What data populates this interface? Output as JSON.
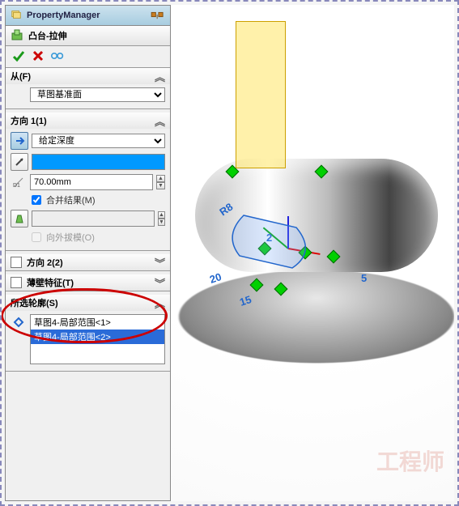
{
  "header": {
    "title": "PropertyManager"
  },
  "feature": {
    "title": "凸台-拉伸"
  },
  "from": {
    "label": "从(F)",
    "value": "草图基准面"
  },
  "dir1": {
    "label": "方向 1(1)",
    "end_condition": "给定深度",
    "depth": "70.00mm",
    "merge_label": "合并结果(M)",
    "merge_checked": true,
    "draft_label": "向外拔模(O)",
    "draft_checked": false
  },
  "dir2": {
    "label": "方向 2(2)"
  },
  "thin": {
    "label": "薄壁特征(T)"
  },
  "contours": {
    "label": "所选轮廓(S)",
    "items": [
      {
        "text": "草图4-局部范围<1>",
        "selected": false
      },
      {
        "text": "草图4-局部范围<2>",
        "selected": true
      }
    ]
  },
  "viewport": {
    "dims": {
      "r": "R8",
      "d20": "20",
      "d15": "15",
      "d5": "5",
      "d2": "2"
    },
    "watermark": "工程师"
  }
}
